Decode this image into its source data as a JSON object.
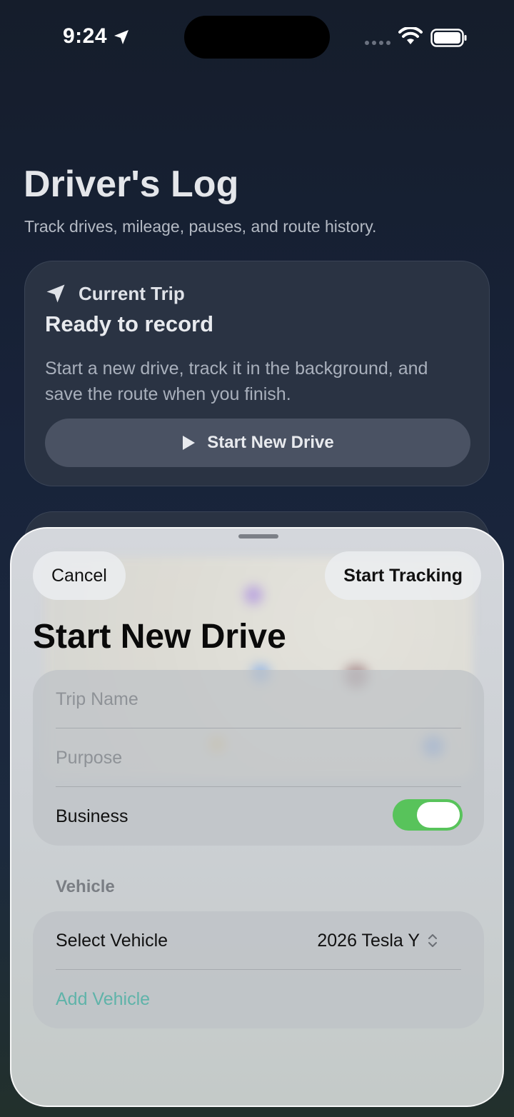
{
  "status_bar": {
    "time": "9:24"
  },
  "header": {
    "title": "Driver's Log",
    "subtitle": "Track drives, mileage, pauses, and route history."
  },
  "current_trip": {
    "label": "Current Trip",
    "status": "Ready to record",
    "description": "Start a new drive, track it in the background, and save the route when you finish.",
    "start_button": "Start New Drive"
  },
  "sheet": {
    "cancel_label": "Cancel",
    "start_tracking_label": "Start Tracking",
    "title": "Start New Drive",
    "trip_name_placeholder": "Trip Name",
    "purpose_placeholder": "Purpose",
    "business_label": "Business",
    "business_enabled": true,
    "vehicle_section": "Vehicle",
    "select_vehicle_label": "Select Vehicle",
    "selected_vehicle": "2026 Tesla Y",
    "add_vehicle_label": "Add Vehicle"
  },
  "colors": {
    "toggle_on": "#58c35b",
    "accent_link": "#5fb3a9",
    "card_bg": "#2a3343"
  }
}
